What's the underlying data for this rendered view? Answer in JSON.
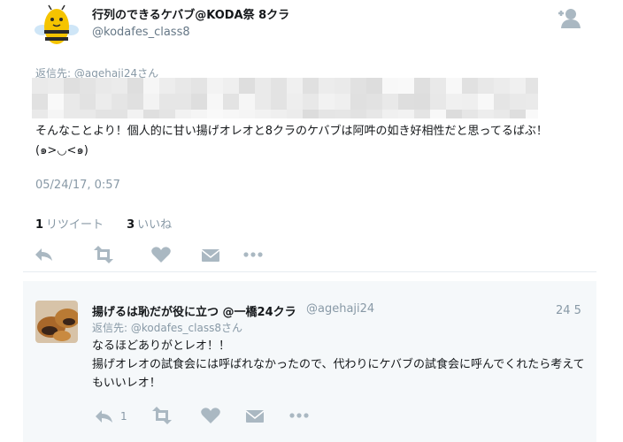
{
  "tweet": {
    "display_name": "行列のできるケバブ@KODA祭 8クラ",
    "handle": "@kodafes_class8",
    "reply_to_prefix": "返信先: ",
    "reply_to_handle": "@agehaji24さん",
    "text_line1": "そんなことより！個人的に甘い揚げオレオと8クラのケバブは阿吽の如き好相性だと思ってるばぶ！",
    "text_line2": "(๑>◡<๑)",
    "timestamp": "05/24/17, 0:57",
    "retweet_count": "1",
    "retweet_label": "リツイート",
    "like_count": "3",
    "like_label": "いいね"
  },
  "reply": {
    "display_name": "揚げるは恥だが役に立つ @一橋24クラ",
    "handle": "@agehaji24",
    "time": "24 5",
    "reply_to": "返信先: @kodafes_class8さん",
    "text_line1": "なるほどありがとレオ！！",
    "text_line2": "揚げオレオの試食会には呼ばれなかったので、代わりにケバブの試食会に呼んでくれたら考えてもいいレオ！",
    "reply_count": "1"
  },
  "colors": {
    "secondary_text": "#8899a6",
    "action_icon": "#aab8c2",
    "card_background": "#f5f8fa"
  },
  "icons": {
    "follow": "add-user-icon",
    "reply": "reply-icon",
    "retweet": "retweet-icon",
    "like": "heart-icon",
    "dm": "envelope-icon",
    "more": "more-icon"
  }
}
